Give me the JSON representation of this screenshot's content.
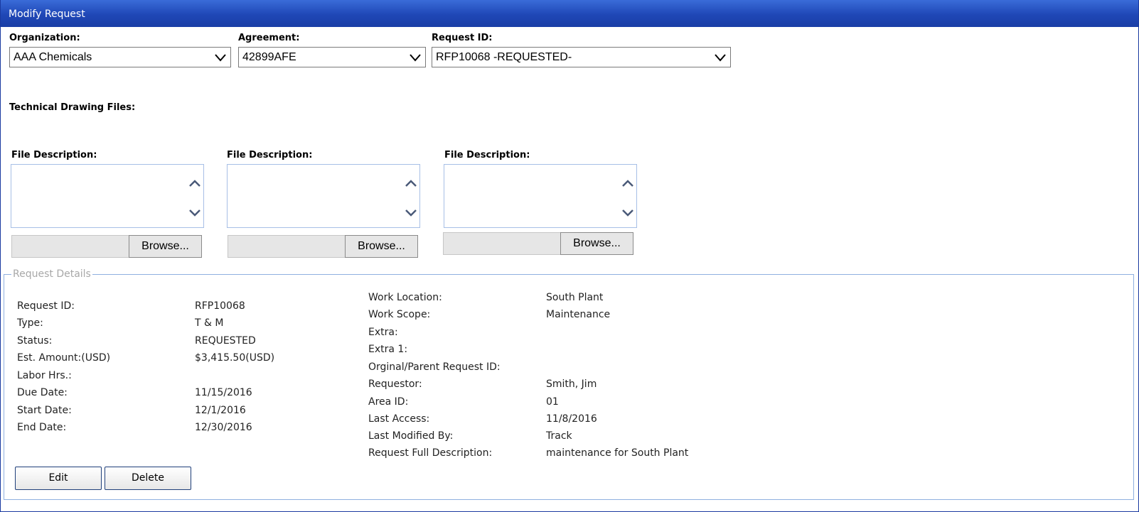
{
  "window": {
    "title": "Modify Request"
  },
  "organization": {
    "label": "Organization:",
    "value": "AAA Chemicals"
  },
  "agreement": {
    "label": "Agreement:",
    "value": "42899AFE"
  },
  "request_id_select": {
    "label": "Request ID:",
    "value": "RFP10068 -REQUESTED-"
  },
  "technical_drawing_files": {
    "label": "Technical Drawing Files:"
  },
  "files": [
    {
      "label": "File Description:",
      "browse_label": "Browse..."
    },
    {
      "label": "File Description:",
      "browse_label": "Browse..."
    },
    {
      "label": "File Description:",
      "browse_label": "Browse..."
    }
  ],
  "details": {
    "legend": "Request Details",
    "left": [
      {
        "label": "Request ID:",
        "value": "RFP10068"
      },
      {
        "label": "Type:",
        "value": "T & M"
      },
      {
        "label": "Status:",
        "value": "REQUESTED"
      },
      {
        "label": "Est. Amount:(USD)",
        "value": "$3,415.50(USD)"
      },
      {
        "label": "Labor Hrs.:",
        "value": ""
      },
      {
        "label": "Due Date:",
        "value": "11/15/2016"
      },
      {
        "label": "Start Date:",
        "value": "12/1/2016"
      },
      {
        "label": "End Date:",
        "value": "12/30/2016"
      }
    ],
    "right": [
      {
        "label": "Work Location:",
        "value": "South Plant"
      },
      {
        "label": "Work Scope:",
        "value": "Maintenance"
      },
      {
        "label": "Extra:",
        "value": ""
      },
      {
        "label": "Extra 1:",
        "value": ""
      },
      {
        "label": "Orginal/Parent Request ID:",
        "value": ""
      },
      {
        "label": "Requestor:",
        "value": "Smith, Jim"
      },
      {
        "label": "Area ID:",
        "value": "01"
      },
      {
        "label": "Last Access:",
        "value": "11/8/2016"
      },
      {
        "label": "Last Modified By:",
        "value": "Track"
      },
      {
        "label": "Request Full Description:",
        "value": "maintenance for South Plant"
      }
    ]
  },
  "actions": {
    "edit_label": "Edit",
    "delete_label": "Delete"
  }
}
